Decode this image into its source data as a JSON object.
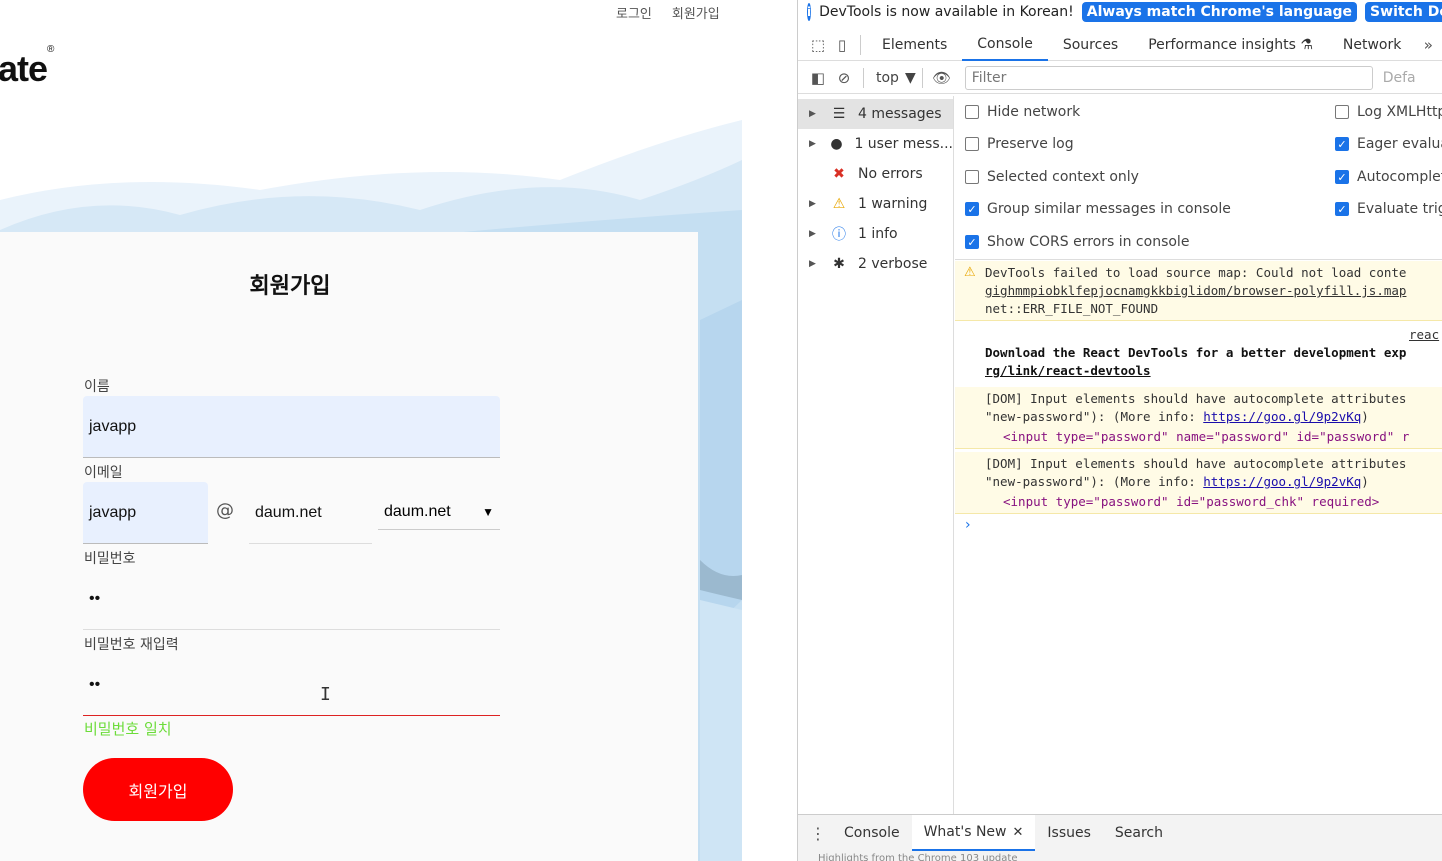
{
  "page": {
    "nav": {
      "login": "로그인",
      "signup": "회원가입"
    },
    "logo": {
      "text": "ate",
      "mark": "®"
    },
    "form": {
      "title": "회원가입",
      "name_label": "이름",
      "name_value": "javapp",
      "email_label": "이메일",
      "email_id_value": "javapp",
      "email_at": "@",
      "email_domain_value": "daum.net",
      "email_domain_select": "daum.net",
      "password_label": "비밀번호",
      "password_value": "••",
      "password_confirm_label": "비밀번호 재입력",
      "password_confirm_value": "••",
      "match_message": "비밀번호 일치",
      "submit_label": "회원가입"
    },
    "colors": {
      "accent": "#ff0000",
      "match": "#6cdc3a",
      "autofill": "#e8f0fe"
    }
  },
  "devtools": {
    "infobar": {
      "message": "DevTools is now available in Korean!",
      "button_match": "Always match Chrome's language",
      "button_switch": "Switch DevTools t"
    },
    "tabs": [
      "Elements",
      "Console",
      "Sources",
      "Performance insights",
      "Network"
    ],
    "active_tab": "Console",
    "toolbar": {
      "context": "top",
      "filter_placeholder": "Filter",
      "levels": "Defa"
    },
    "sidebar": [
      {
        "label": "4 messages",
        "icon": "list-icon"
      },
      {
        "label": "1 user mess...",
        "icon": "user-icon"
      },
      {
        "label": "No errors",
        "icon": "error-icon"
      },
      {
        "label": "1 warning",
        "icon": "warning-icon"
      },
      {
        "label": "1 info",
        "icon": "info-icon"
      },
      {
        "label": "2 verbose",
        "icon": "bug-icon"
      }
    ],
    "settings_left": [
      {
        "label": "Hide network",
        "checked": false
      },
      {
        "label": "Preserve log",
        "checked": false
      },
      {
        "label": "Selected context only",
        "checked": false
      },
      {
        "label": "Group similar messages in console",
        "checked": true
      },
      {
        "label": "Show CORS errors in console",
        "checked": true
      }
    ],
    "settings_right": [
      {
        "label": "Log XMLHttp",
        "checked": false
      },
      {
        "label": "Eager evaluat",
        "checked": true
      },
      {
        "label": "Autocomplet",
        "checked": true
      },
      {
        "label": "Evaluate trig",
        "checked": true
      }
    ],
    "console": {
      "warn1_line1": "DevTools failed to load source map: Could not load conte",
      "warn1_line2": "gighmmpiobklfepjocnamgkkbiglidom/browser-polyfill.js.map",
      "warn1_line3": "net::ERR_FILE_NOT_FOUND",
      "react_src": "reac",
      "react_line1": "Download the React DevTools for a better development exp",
      "react_line2": "rg/link/react-devtools",
      "dom_line1": "[DOM] Input elements should have autocomplete attributes",
      "dom_line2_pre": "\"new-password\"): (More info: ",
      "dom_link": "https://goo.gl/9p2vKq",
      "dom_line2_post": ")",
      "dom1_code": "<input type=\"password\" name=\"password\" id=\"password\" r",
      "dom2_code": "<input type=\"password\" id=\"password_chk\" required>",
      "prompt": "›"
    },
    "drawer": {
      "tabs": [
        "Console",
        "What's New",
        "Issues",
        "Search"
      ],
      "active": "What's New",
      "subtext": "Highlights from the Chrome 103 update"
    }
  }
}
